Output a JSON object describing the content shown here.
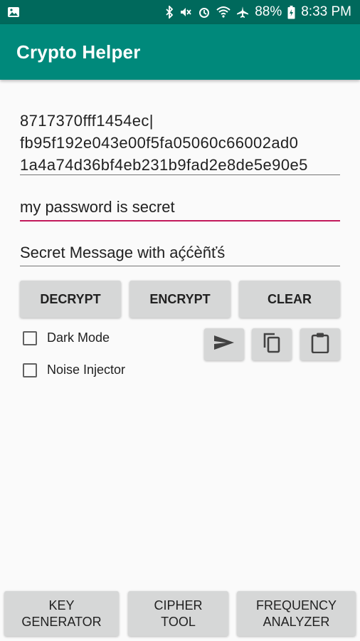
{
  "status_bar": {
    "battery": "88%",
    "time": "8:33 PM"
  },
  "app_bar": {
    "title": "Crypto Helper"
  },
  "fields": {
    "ciphertext": "8717370fff1454ec|\nfb95f192e043e00f5fa05060c66002ad0\n1a4a74d36bf4eb231b9fad2e8de5e90e5",
    "password": "my password is secret",
    "message": "Secret Message with aḉćèñťś"
  },
  "actions": {
    "decrypt": "DECRYPT",
    "encrypt": "ENCRYPT",
    "clear": "CLEAR"
  },
  "options": {
    "dark_mode": "Dark Mode",
    "noise_injector": "Noise Injector"
  },
  "bottom_nav": {
    "key_generator": [
      "KEY",
      "GENERATOR"
    ],
    "cipher_tool": [
      "CIPHER",
      "TOOL"
    ],
    "frequency_analyzer": [
      "FREQUENCY",
      "ANALYZER"
    ]
  },
  "icons": {
    "send": "send-icon",
    "copy": "copy-icon",
    "paste": "clipboard-icon"
  },
  "colors": {
    "status_bar": "#00695c",
    "app_bar": "#00897b",
    "accent": "#c2185b",
    "button": "#d6d7d7"
  }
}
